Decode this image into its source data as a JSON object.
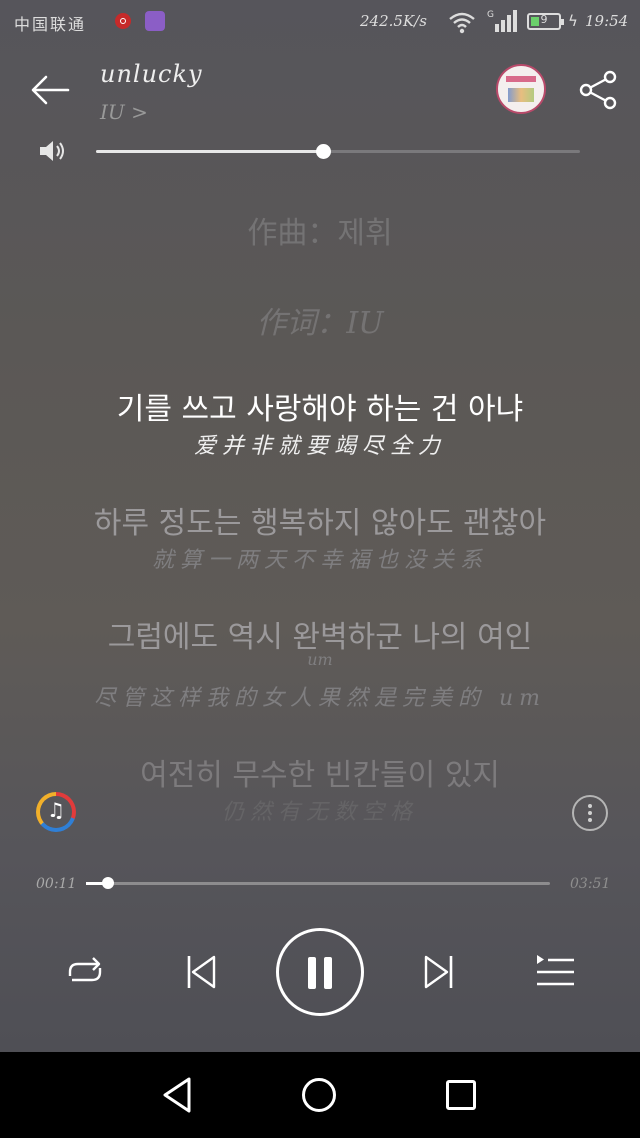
{
  "status_bar": {
    "carrier": "中国联通",
    "speed": "242.5K/s",
    "network": "G",
    "battery": "9",
    "time": "19:54"
  },
  "header": {
    "title": "unlucky",
    "artist": "IU >"
  },
  "volume": {
    "level": 0.47
  },
  "lyrics": {
    "composer": "作曲：제휘",
    "lyricist": "作词：IU",
    "lines": [
      {
        "kr": "기를 쓰고 사랑해야 하는 건 아냐",
        "cn": "爱并非就要竭尽全力"
      },
      {
        "kr": "하루 정도는 행복하지 않아도 괜찮아",
        "cn": "就算一两天不幸福也没关系"
      },
      {
        "kr": "그럼에도 역시 완벽하군 나의 여인",
        "extra": "um",
        "cn": "尽管这样我的女人果然是完美的 um"
      },
      {
        "kr": "여전히 무수한 빈칸들이 있지",
        "cn": "仍然有无数空格"
      }
    ]
  },
  "player": {
    "current_time": "00:11",
    "total_time": "03:51",
    "progress": 0.048,
    "music_note": "♫"
  },
  "icons": {
    "back": "back-arrow-icon",
    "share": "share-icon",
    "volume": "speaker-icon",
    "repeat": "repeat-icon",
    "prev": "skip-previous-icon",
    "pause": "pause-icon",
    "next": "skip-next-icon",
    "playlist": "playlist-icon",
    "more": "more-vertical-icon"
  }
}
